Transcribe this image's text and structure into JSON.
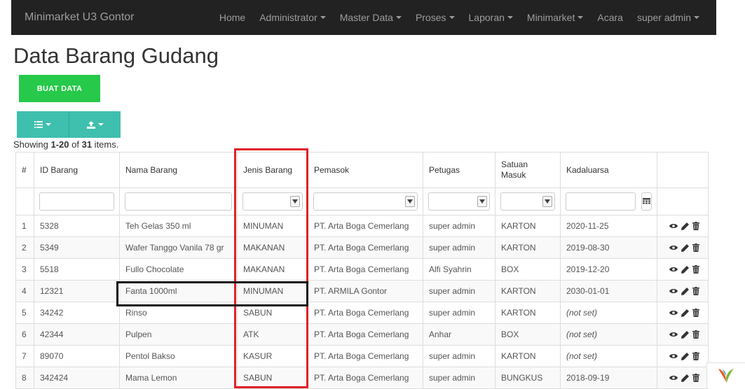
{
  "navbar": {
    "brand": "Minimarket U3 Gontor",
    "items": [
      {
        "label": "Home",
        "dropdown": false
      },
      {
        "label": "Administrator",
        "dropdown": true
      },
      {
        "label": "Master Data",
        "dropdown": true
      },
      {
        "label": "Proses",
        "dropdown": true
      },
      {
        "label": "Laporan",
        "dropdown": true
      },
      {
        "label": "Minimarket",
        "dropdown": true
      },
      {
        "label": "Acara",
        "dropdown": false
      },
      {
        "label": "super admin",
        "dropdown": true
      }
    ]
  },
  "page": {
    "title": "Data Barang Gudang",
    "create_button": "BUAT DATA",
    "summary": {
      "prefix": "Showing ",
      "range": "1-20",
      "middle": " of ",
      "total": "31",
      "suffix": " items."
    }
  },
  "colors": {
    "navbar_bg": "#222222",
    "create_button": "#26c94a",
    "toolbar_button": "#3fbfae",
    "highlight_red": "#e0202a",
    "highlight_black": "#111111"
  },
  "table": {
    "headers": [
      "#",
      "ID Barang",
      "Nama Barang",
      "Jenis Barang",
      "Pemasok",
      "Petugas",
      "Satuan Masuk",
      "Kadaluarsa",
      ""
    ],
    "rows": [
      {
        "no": "1",
        "id": "5328",
        "nama": "Teh Gelas 350 ml",
        "jenis": "MINUMAN",
        "pemasok": "PT. Arta Boga Cemerlang",
        "petugas": "super admin",
        "satuan": "KARTON",
        "kadaluarsa": "2020-11-25"
      },
      {
        "no": "2",
        "id": "5349",
        "nama": "Wafer Tanggo Vanila 78 gr",
        "jenis": "MAKANAN",
        "pemasok": "PT. Arta Boga Cemerlang",
        "petugas": "super admin",
        "satuan": "KARTON",
        "kadaluarsa": "2019-08-30"
      },
      {
        "no": "3",
        "id": "5518",
        "nama": "Fullo Chocolate",
        "jenis": "MAKANAN",
        "pemasok": "PT. Arta Boga Cemerlang",
        "petugas": "Alfi Syahrin",
        "satuan": "BOX",
        "kadaluarsa": "2019-12-20"
      },
      {
        "no": "4",
        "id": "12321",
        "nama": "Fanta 1000ml",
        "jenis": "MINUMAN",
        "pemasok": "PT. ARMILA Gontor",
        "petugas": "super admin",
        "satuan": "KARTON",
        "kadaluarsa": "2030-01-01"
      },
      {
        "no": "5",
        "id": "34242",
        "nama": "Rinso",
        "jenis": "SABUN",
        "pemasok": "PT. Arta Boga Cemerlang",
        "petugas": "super admin",
        "satuan": "KARTON",
        "kadaluarsa": "(not set)"
      },
      {
        "no": "6",
        "id": "42344",
        "nama": "Pulpen",
        "jenis": "ATK",
        "pemasok": "PT. Arta Boga Cemerlang",
        "petugas": "Anhar",
        "satuan": "BOX",
        "kadaluarsa": "(not set)"
      },
      {
        "no": "7",
        "id": "89070",
        "nama": "Pentol Bakso",
        "jenis": "KASUR",
        "pemasok": "PT. Arta Boga Cemerlang",
        "petugas": "super admin",
        "satuan": "KARTON",
        "kadaluarsa": "(not set)"
      },
      {
        "no": "8",
        "id": "342424",
        "nama": "Mama Lemon",
        "jenis": "SABUN",
        "pemasok": "PT. Arta Boga Cemerlang",
        "petugas": "super admin",
        "satuan": "BUNGKUS",
        "kadaluarsa": "2018-09-19"
      }
    ]
  }
}
